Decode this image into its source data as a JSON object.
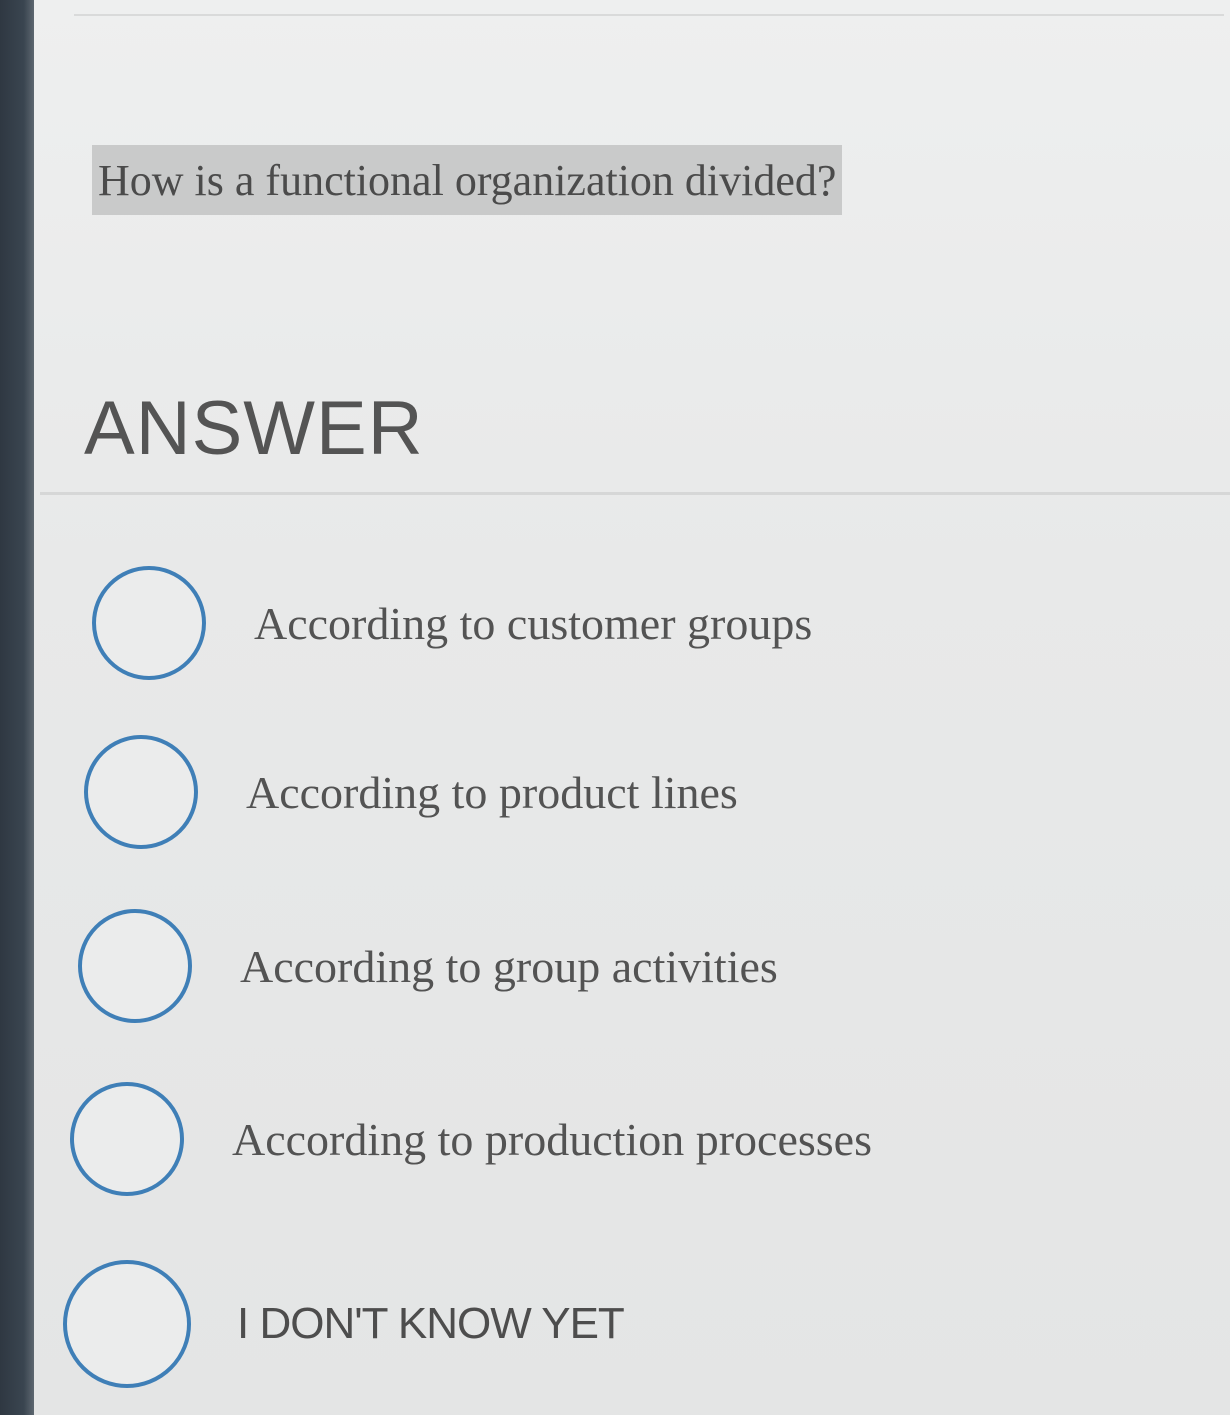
{
  "question": {
    "text": "How is a functional organization divided?"
  },
  "answer_section": {
    "heading": "ANSWER"
  },
  "options": [
    {
      "label": "According to customer groups",
      "selected": false
    },
    {
      "label": "According to product lines",
      "selected": false
    },
    {
      "label": "According to group activities",
      "selected": false
    },
    {
      "label": "According to production processes",
      "selected": false
    },
    {
      "label": "I DON'T KNOW YET",
      "selected": false
    }
  ],
  "colors": {
    "radio_border": "#3f7fb7",
    "background": "#e9eaea",
    "question_highlight": "#c9caca",
    "text": "#535353"
  }
}
